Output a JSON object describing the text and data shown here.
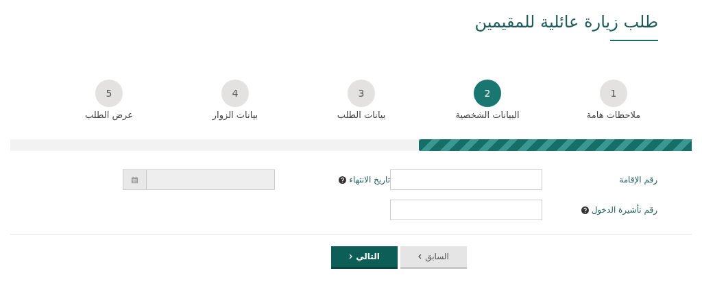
{
  "title": "طلب زيارة عائلية للمقيمين",
  "steps": [
    {
      "number": "1",
      "label": "ملاحظات هامة",
      "selected": false
    },
    {
      "number": "2",
      "label": "البيانات الشخصية",
      "selected": true
    },
    {
      "number": "3",
      "label": "بيانات الطلب",
      "selected": false
    },
    {
      "number": "4",
      "label": "بيانات الزوار",
      "selected": false
    },
    {
      "number": "5",
      "label": "عرض الطلب",
      "selected": false
    }
  ],
  "progress": {
    "level": 0.4
  },
  "fields": [
    {
      "label": "رقم الإقامة",
      "kind": "text",
      "help": false,
      "disabled": false
    },
    {
      "label": "تاريخ الانتهاء",
      "kind": "date",
      "help": true,
      "disabled": true
    },
    {
      "label": "رقم تأشيرة الدخول",
      "kind": "text",
      "help": true,
      "disabled": false
    }
  ],
  "buttons": [
    {
      "label": "السابق",
      "kind": "secondary"
    },
    {
      "label": "التالي",
      "kind": "primary"
    }
  ]
}
